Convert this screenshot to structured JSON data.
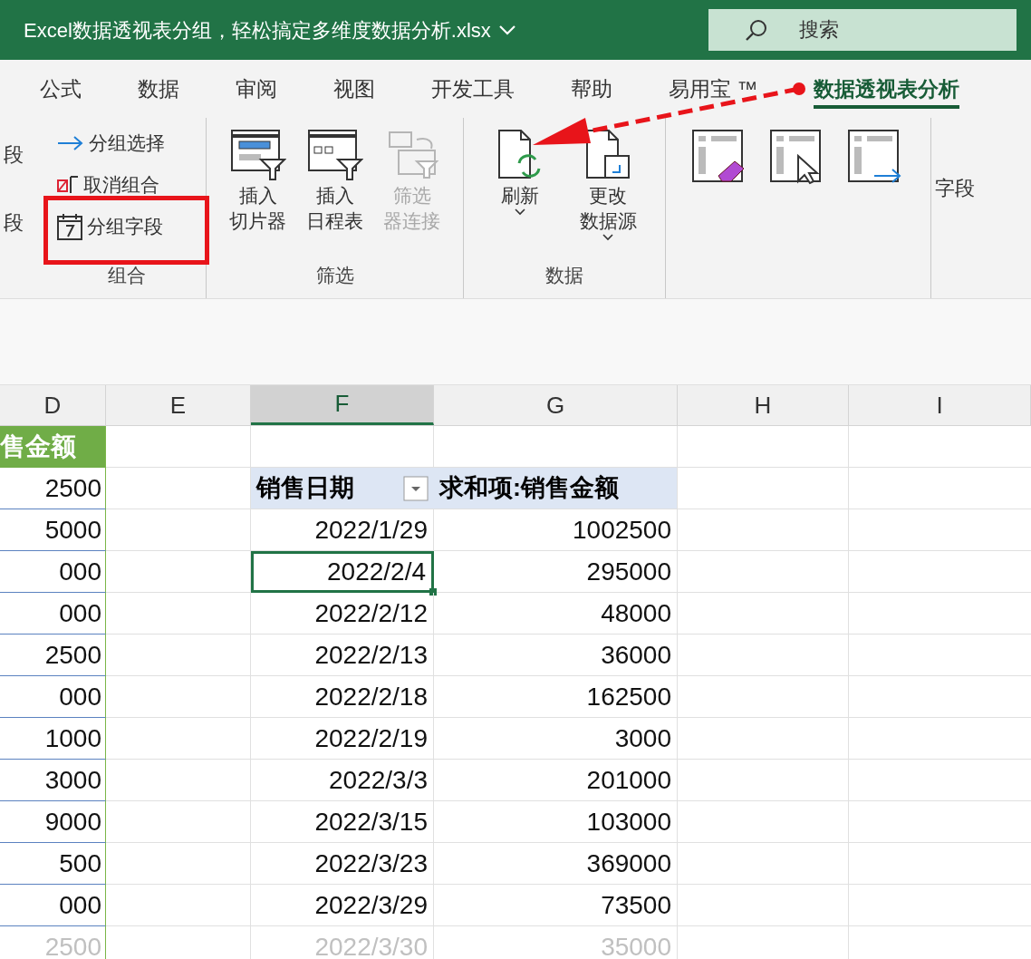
{
  "window": {
    "title": "Excel数据透视表分组，轻松搞定多维度数据分析.xlsx"
  },
  "search": {
    "placeholder": "搜索"
  },
  "tabs": [
    {
      "label": "公式",
      "selected": false
    },
    {
      "label": "数据",
      "selected": false
    },
    {
      "label": "审阅",
      "selected": false
    },
    {
      "label": "视图",
      "selected": false
    },
    {
      "label": "开发工具",
      "selected": false
    },
    {
      "label": "帮助",
      "selected": false
    },
    {
      "label": "易用宝 ™",
      "selected": false
    },
    {
      "label": "数据透视表分析",
      "selected": true
    }
  ],
  "ribbon": {
    "groups": [
      {
        "kind": "cut",
        "items": [
          {
            "label": "段"
          },
          {
            "label": "段"
          }
        ]
      },
      {
        "kind": "small",
        "title": "组合",
        "items": [
          {
            "label": "分组选择",
            "annotated": false
          },
          {
            "label": "取消组合",
            "annotated": false
          },
          {
            "label": "分组字段",
            "annotated": true
          }
        ]
      },
      {
        "kind": "large",
        "title": "筛选",
        "items": [
          {
            "lines": [
              "插入",
              "切片器"
            ],
            "disabled": false,
            "dropdown": false
          },
          {
            "lines": [
              "插入",
              "日程表"
            ],
            "disabled": false,
            "dropdown": false
          },
          {
            "lines": [
              "筛选",
              "器连接"
            ],
            "disabled": true,
            "dropdown": false
          }
        ]
      },
      {
        "kind": "large",
        "title": "数据",
        "items": [
          {
            "lines": [
              "刷新"
            ],
            "disabled": false,
            "dropdown": true
          },
          {
            "lines": [
              "更改",
              "数据源"
            ],
            "disabled": false,
            "dropdown": true
          }
        ]
      },
      {
        "kind": "icons"
      },
      {
        "kind": "cut",
        "items": [
          {
            "label": "字段"
          }
        ]
      }
    ]
  },
  "sheet": {
    "columns": [
      {
        "label": "D",
        "selected": false
      },
      {
        "label": "E",
        "selected": false
      },
      {
        "label": "F",
        "selected": true
      },
      {
        "label": "G",
        "selected": false
      },
      {
        "label": "H",
        "selected": false
      },
      {
        "label": "I",
        "selected": false
      }
    ],
    "column_d": [
      {
        "text": "售金额",
        "kind": "header"
      },
      {
        "text": "2500",
        "kind": "value"
      },
      {
        "text": "5000",
        "kind": "value"
      },
      {
        "text": "000",
        "kind": "value"
      },
      {
        "text": "000",
        "kind": "value"
      },
      {
        "text": "2500",
        "kind": "value"
      },
      {
        "text": "000",
        "kind": "value"
      },
      {
        "text": "1000",
        "kind": "value"
      },
      {
        "text": "3000",
        "kind": "value"
      },
      {
        "text": "9000",
        "kind": "value"
      },
      {
        "text": "500",
        "kind": "value"
      },
      {
        "text": "000",
        "kind": "value"
      },
      {
        "text": "2500",
        "kind": "value"
      }
    ],
    "pivot": {
      "row_label": "销售日期",
      "value_label": "求和项:销售金额",
      "rows": [
        {
          "date": "2022/1/29",
          "amount": "1002500",
          "selected": false
        },
        {
          "date": "2022/2/4",
          "amount": "295000",
          "selected": true
        },
        {
          "date": "2022/2/12",
          "amount": "48000",
          "selected": false
        },
        {
          "date": "2022/2/13",
          "amount": "36000",
          "selected": false
        },
        {
          "date": "2022/2/18",
          "amount": "162500",
          "selected": false
        },
        {
          "date": "2022/2/19",
          "amount": "3000",
          "selected": false
        },
        {
          "date": "2022/3/3",
          "amount": "201000",
          "selected": false
        },
        {
          "date": "2022/3/15",
          "amount": "103000",
          "selected": false
        },
        {
          "date": "2022/3/23",
          "amount": "369000",
          "selected": false
        },
        {
          "date": "2022/3/29",
          "amount": "73500",
          "selected": false
        },
        {
          "date": "2022/3/30",
          "amount": "35000",
          "selected": false
        }
      ]
    }
  }
}
